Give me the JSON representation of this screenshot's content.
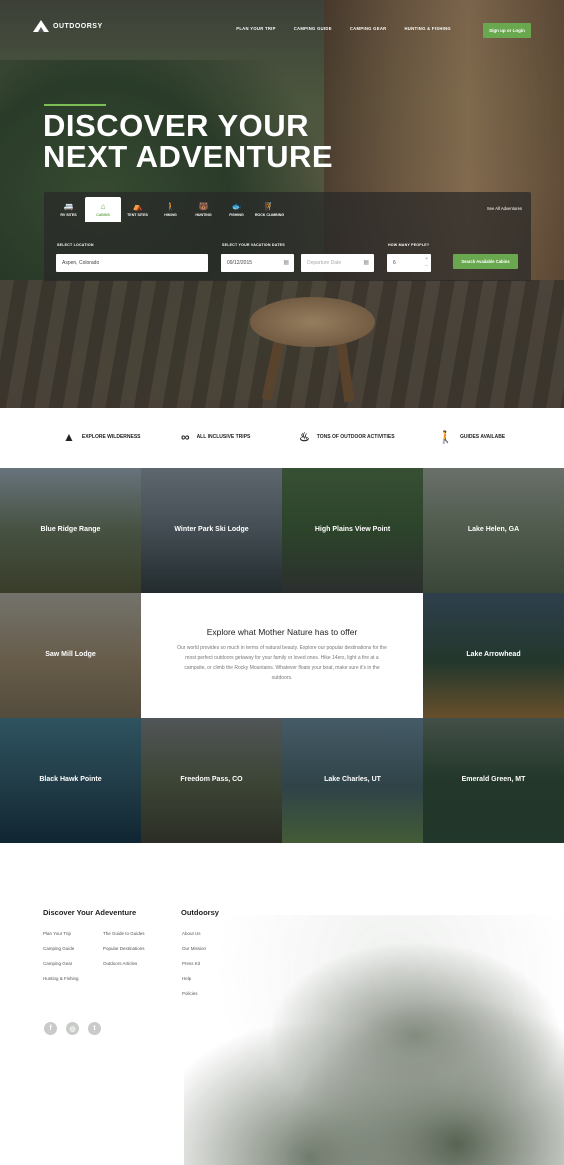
{
  "brand": {
    "name": "OUTDOORSY"
  },
  "nav": {
    "links": [
      "PLAN YOUR TRIP",
      "CAMPING GUIDE",
      "CAMPING GEAR",
      "HUNTING & FISHING"
    ],
    "signup": "Sign up or Login"
  },
  "hero": {
    "headline_1": "DISCOVER YOUR",
    "headline_2": "NEXT ADVENTURE"
  },
  "search": {
    "tabs": [
      {
        "label": "RV SITES",
        "icon": "rv-icon"
      },
      {
        "label": "CABINS",
        "icon": "cabin-icon",
        "active": true
      },
      {
        "label": "TENT SITES",
        "icon": "tent-icon"
      },
      {
        "label": "HIKING",
        "icon": "hiker-icon"
      },
      {
        "label": "HUNTING",
        "icon": "hunting-icon"
      },
      {
        "label": "FISHING",
        "icon": "fishing-icon"
      },
      {
        "label": "ROCK CLIMBING",
        "icon": "climbing-icon"
      }
    ],
    "see_all": "See All Adventures",
    "location_label": "SELECT LOCATION",
    "location_value": "Aspen, Colorado",
    "dates_label": "SELECT YOUR VACATION DATES",
    "arrival_value": "09/12/2015",
    "departure_placeholder": "Departure Date",
    "people_label": "HOW MANY PEOPLE?",
    "people_value": "6",
    "button": "Search Available Cabins"
  },
  "features": [
    {
      "label": "EXPLORE WILDERNESS",
      "icon": "tree-icon"
    },
    {
      "label": "ALL INCLUSIVE TRIPS",
      "icon": "infinity-icon"
    },
    {
      "label": "TONS OF OUTDOOR ACTIVITIES",
      "icon": "campfire-icon"
    },
    {
      "label": "GUIDES AVAILABE",
      "icon": "hiker-icon"
    }
  ],
  "destinations": [
    "Blue Ridge Range",
    "Winter Park Ski Lodge",
    "High Plains View Point",
    "Lake Helen, GA",
    "Saw Mill Lodge",
    "Lake Arrowhead",
    "Black Hawk Pointe",
    "Freedom Pass, CO",
    "Lake Charles, UT",
    "Emerald Green, MT"
  ],
  "explore": {
    "title": "Explore what Mother Nature has to offer",
    "text": "Our world provides so much in terms of natural beauty. Explore our popular destinations for the most perfect outdoors getaway for your family or loved ones. Hike 14ers, light a fire at a campsite, or climb the Rocky Mountains. Whatever floats your boat, make sure it's in the outdoors."
  },
  "footer": {
    "col1_title": "Discover Your Adeventure",
    "col1_links_a": [
      "Plan Your Trip",
      "Camping Guide",
      "Camping Gear",
      "Hunting & Fishing"
    ],
    "col1_links_b": [
      "The Guide to Guides",
      "Popular Destinations",
      "Outdoors Articles"
    ],
    "col2_title": "Outdoorsy",
    "col2_links": [
      "About Us",
      "Our Mission",
      "Press Kit",
      "Help",
      "Policies"
    ],
    "social": [
      "facebook-icon",
      "instagram-icon",
      "twitter-icon"
    ]
  },
  "colors": {
    "accent": "#6aa84f",
    "dark": "#222222"
  }
}
